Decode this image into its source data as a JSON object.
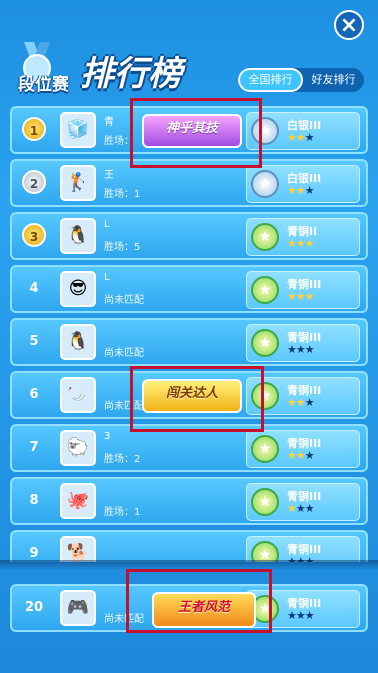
{
  "close_label": "×",
  "header": {
    "title_small": "段位赛",
    "title_big": "排行榜",
    "tabs": [
      "全国排行",
      "好友排行"
    ]
  },
  "rows": [
    {
      "rank": "1",
      "medal": "gold",
      "name": "青",
      "stat": "胜场：",
      "tier": "白银III",
      "tier_icon": "silver",
      "stars": 2,
      "avatar": "🧊",
      "stamp": "神乎其技"
    },
    {
      "rank": "2",
      "medal": "silver",
      "name": "王",
      "stat": "胜场：1",
      "tier": "白银III",
      "tier_icon": "silver",
      "stars": 2,
      "avatar": "🏌"
    },
    {
      "rank": "3",
      "medal": "gold",
      "name": "L",
      "stat": "胜场：5",
      "tier": "青铜II",
      "tier_icon": "bronze",
      "stars": 3,
      "avatar": "🐧"
    },
    {
      "rank": "4",
      "medal": "",
      "name": "L",
      "stat": "尚未匹配",
      "tier": "青铜III",
      "tier_icon": "bronze",
      "stars": 3,
      "avatar": "😎"
    },
    {
      "rank": "5",
      "medal": "",
      "name": "",
      "stat": "尚未匹配",
      "tier": "青铜III",
      "tier_icon": "bronze",
      "stars": 0,
      "avatar": "🐧"
    },
    {
      "rank": "6",
      "medal": "",
      "name": "",
      "stat": "尚未匹配",
      "tier": "青铜III",
      "tier_icon": "bronze",
      "stars": 2,
      "avatar": "🦢",
      "stamp": "闯关达人"
    },
    {
      "rank": "7",
      "medal": "",
      "name": "3",
      "stat": "胜场：2",
      "tier": "青铜III",
      "tier_icon": "bronze",
      "stars": 2,
      "avatar": "🐑"
    },
    {
      "rank": "8",
      "medal": "",
      "name": "",
      "stat": "胜场：1",
      "tier": "青铜III",
      "tier_icon": "bronze",
      "stars": 1,
      "avatar": "🐙"
    },
    {
      "rank": "9",
      "medal": "",
      "name": "",
      "stat": "",
      "tier": "青铜III",
      "tier_icon": "bronze",
      "stars": 0,
      "avatar": "🐕"
    }
  ],
  "self_row": {
    "rank": "20",
    "name": "",
    "stat": "尚未匹配",
    "tier": "青铜III",
    "tier_icon": "bronze",
    "stars": 0,
    "avatar": "🎮",
    "stamp": "王者风范"
  },
  "colors": {
    "annot": "#c8102e",
    "star_on": "#ffd23a",
    "star_off": "#0b3b78"
  }
}
